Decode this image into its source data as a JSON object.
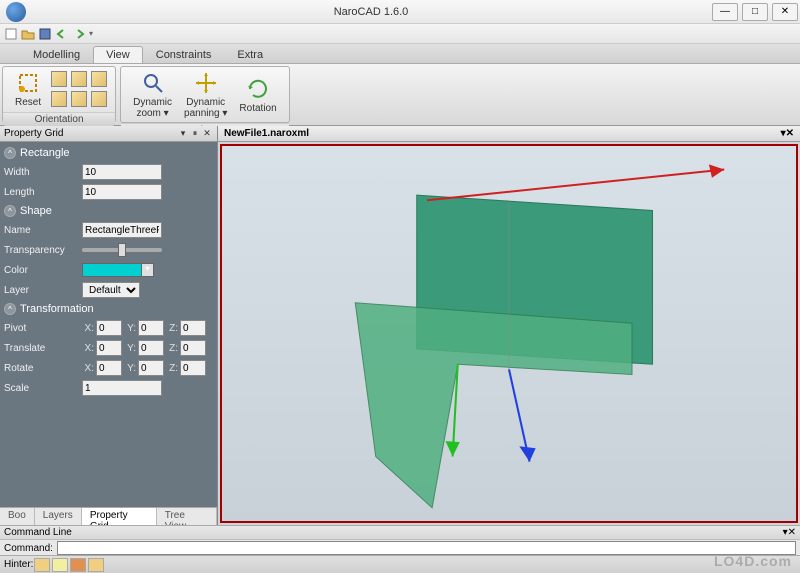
{
  "window": {
    "title": "NaroCAD 1.6.0"
  },
  "ribbon": {
    "tabs": [
      "Modelling",
      "View",
      "Constraints",
      "Extra"
    ],
    "active_tab": "View",
    "groups": {
      "orientation": {
        "label": "Orientation",
        "reset": "Reset"
      },
      "view": {
        "label": "View",
        "zoom": "Dynamic\nzoom ▾",
        "pan": "Dynamic\npanning ▾",
        "rot": "Rotation"
      }
    }
  },
  "panel": {
    "title": "Property Grid",
    "sections": {
      "rectangle": {
        "label": "Rectangle",
        "width_label": "Width",
        "width": "10",
        "length_label": "Length",
        "length": "10"
      },
      "shape": {
        "label": "Shape",
        "name_label": "Name",
        "name": "RectangleThreePo",
        "transparency_label": "Transparency",
        "color_label": "Color",
        "layer_label": "Layer",
        "layer": "Default"
      },
      "transformation": {
        "label": "Transformation",
        "pivot_label": "Pivot",
        "pivot": {
          "x": "0",
          "y": "0",
          "z": "0"
        },
        "translate_label": "Translate",
        "translate": {
          "x": "0",
          "y": "0",
          "z": "0"
        },
        "rotate_label": "Rotate",
        "rotate": {
          "x": "0",
          "y": "0",
          "z": "0"
        },
        "scale_label": "Scale",
        "scale": "1"
      }
    },
    "bottom_tabs": [
      "Boo",
      "Layers",
      "Property Grid",
      "Tree View"
    ],
    "active_bottom_tab": "Property Grid"
  },
  "document": {
    "name": "NewFile1.naroxml"
  },
  "commandline": {
    "title": "Command Line",
    "label": "Command:",
    "value": ""
  },
  "hinter": {
    "label": "Hinter:"
  },
  "watermark": "LO4D.com"
}
